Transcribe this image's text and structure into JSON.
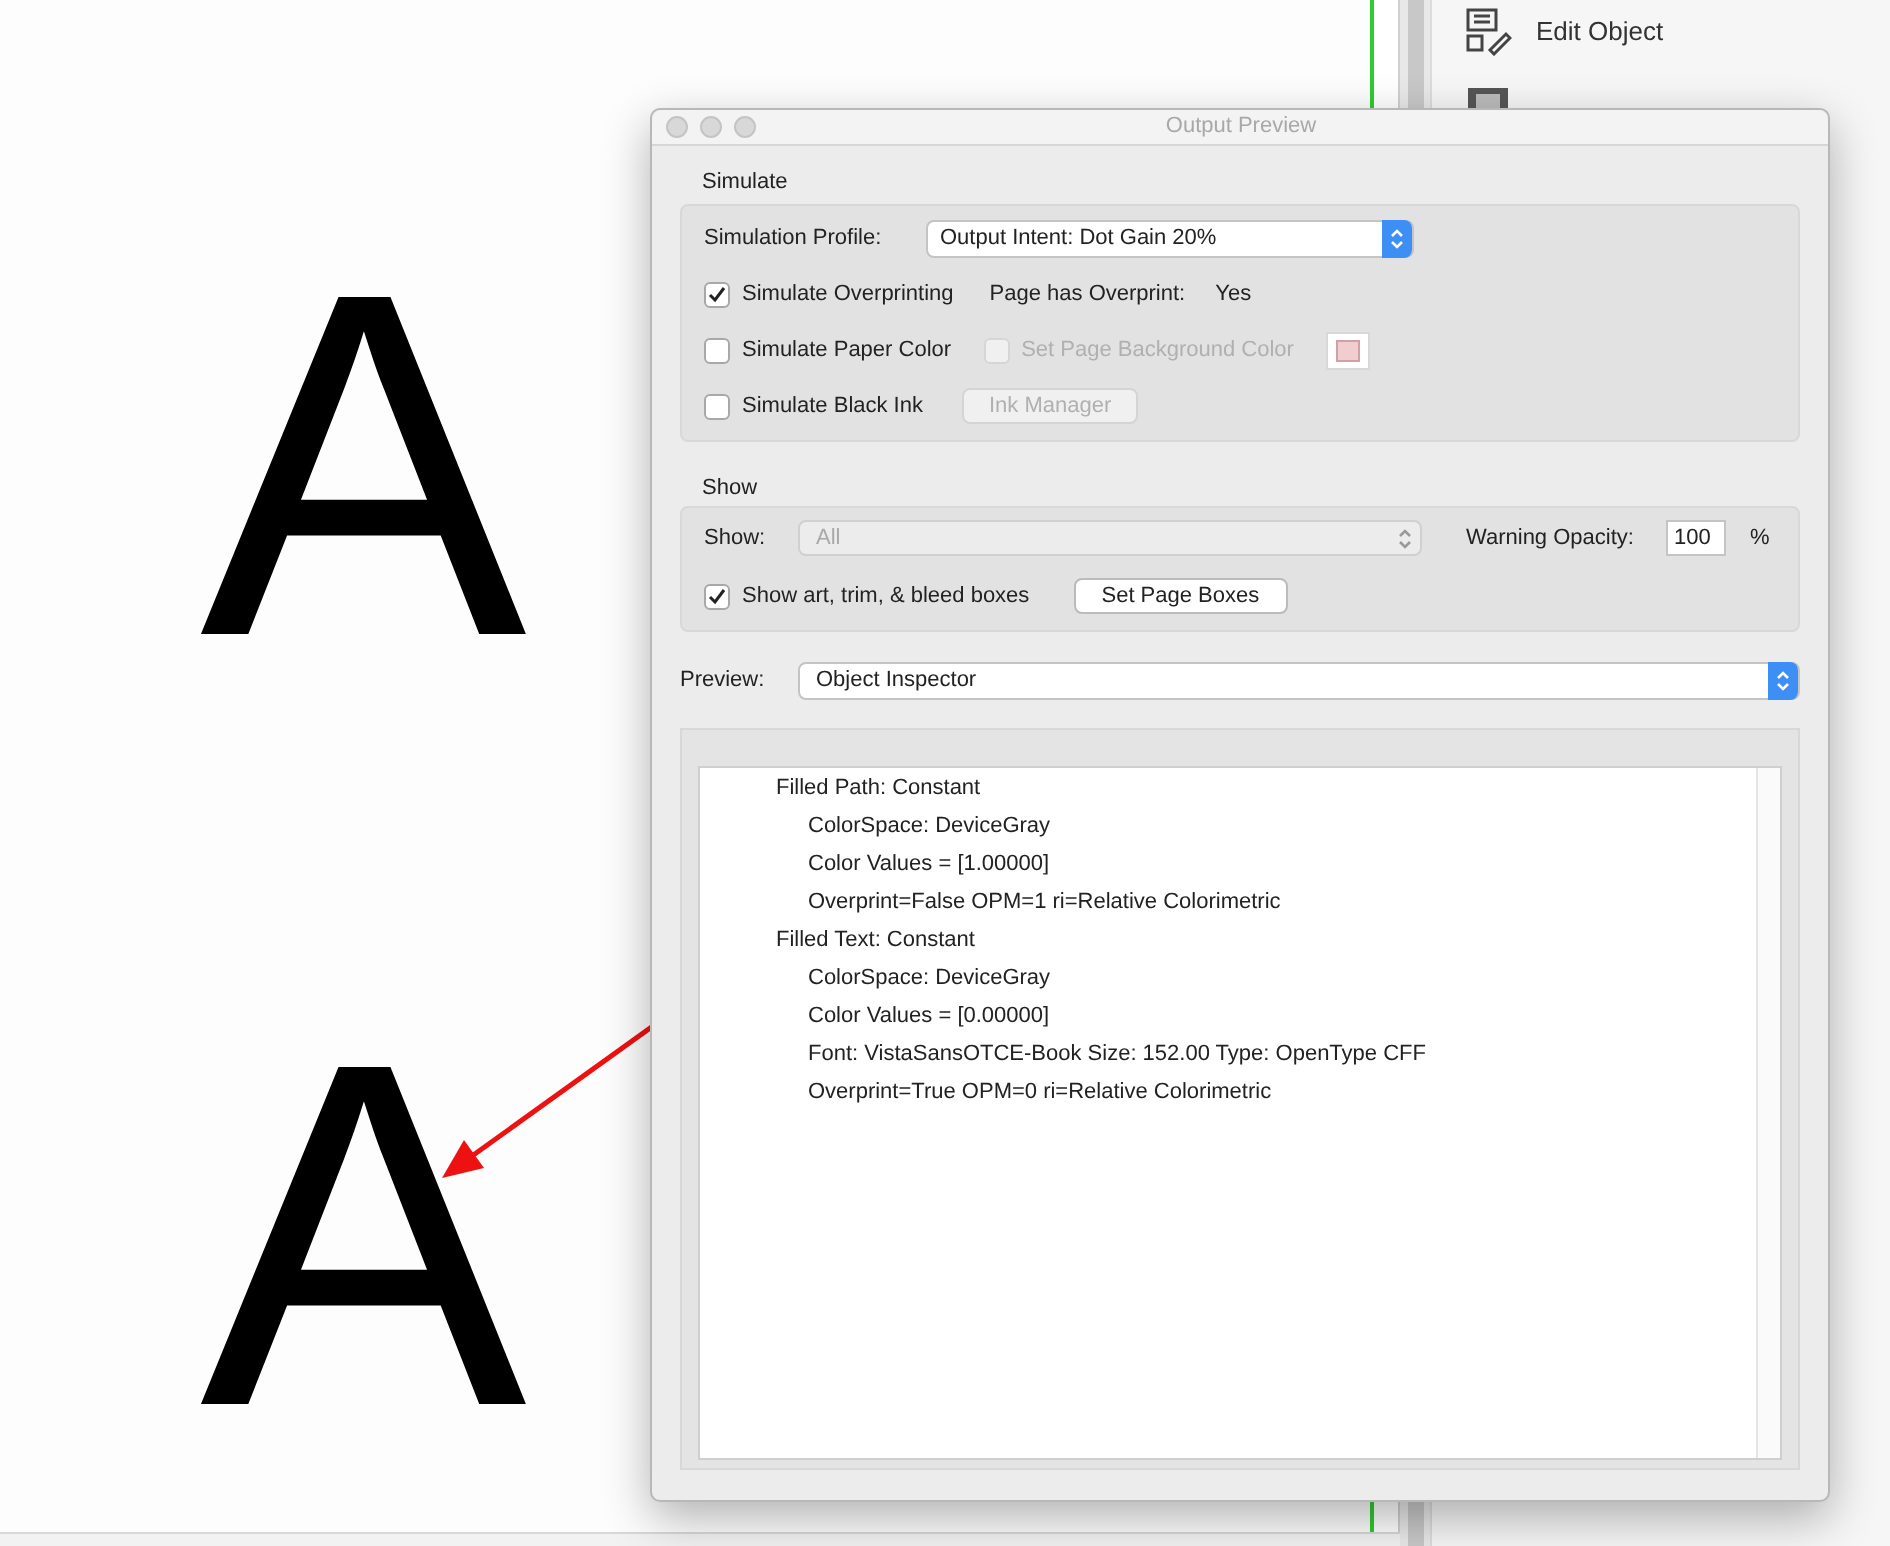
{
  "document": {
    "glyphs": [
      "A",
      "A"
    ]
  },
  "side_panel": {
    "items": [
      {
        "label": "Edit Object"
      }
    ]
  },
  "dialog": {
    "title": "Output Preview",
    "simulate": {
      "heading": "Simulate",
      "profile_label": "Simulation Profile:",
      "profile_value": "Output Intent: Dot Gain 20%",
      "overprinting": {
        "label": "Simulate Overprinting",
        "checked": true,
        "disabled": false
      },
      "page_overprint_label": "Page has Overprint:",
      "page_overprint_value": "Yes",
      "paper_color": {
        "label": "Simulate Paper Color",
        "checked": false,
        "disabled": false
      },
      "page_background": {
        "label": "Set Page Background Color",
        "checked": false,
        "disabled": true
      },
      "black_ink": {
        "label": "Simulate Black Ink",
        "checked": false,
        "disabled": false
      },
      "ink_manager": {
        "label": "Ink Manager",
        "disabled": true
      }
    },
    "show": {
      "heading": "Show",
      "show_label": "Show:",
      "show_value": "All",
      "show_disabled": true,
      "opacity_label": "Warning Opacity:",
      "opacity_value": "100",
      "percent": "%",
      "boxes": {
        "label": "Show art, trim, & bleed boxes",
        "checked": true,
        "disabled": false
      },
      "set_page_boxes": {
        "label": "Set Page Boxes",
        "disabled": false
      }
    },
    "preview": {
      "label": "Preview:",
      "value": "Object Inspector"
    },
    "inspector": {
      "items": [
        {
          "text": "Filled Path: Constant",
          "children": [
            {
              "text": "ColorSpace: DeviceGray"
            },
            {
              "text": "Color Values = [1.00000]"
            },
            {
              "text": "Overprint=False OPM=1 ri=Relative Colorimetric"
            }
          ]
        },
        {
          "text": "Filled Text: Constant",
          "children": [
            {
              "text": "ColorSpace: DeviceGray"
            },
            {
              "text": "Color Values = [0.00000]"
            },
            {
              "text": "Font: VistaSansOTCE-Book Size: 152.00 Type: OpenType CFF"
            },
            {
              "text": "Overprint=True OPM=0 ri=Relative Colorimetric"
            }
          ]
        }
      ]
    }
  }
}
